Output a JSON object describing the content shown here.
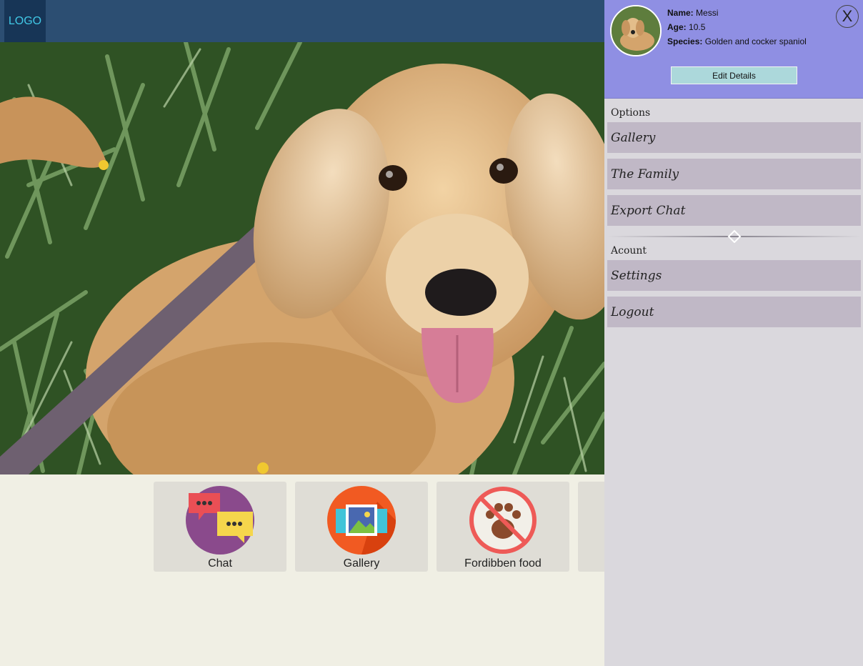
{
  "header": {
    "logo": "LOGO"
  },
  "tiles": [
    {
      "label": "Chat",
      "icon": "chat-icon"
    },
    {
      "label": "Gallery",
      "icon": "gallery-icon"
    },
    {
      "label": "Fordibben food",
      "icon": "forbidden-food-icon"
    }
  ],
  "profile": {
    "name_label": "Name:",
    "name": "Messi",
    "age_label": "Age:",
    "age": "10.5",
    "species_label": "Species:",
    "species": "Golden and cocker spaniol",
    "close": "X",
    "edit": "Edit Details"
  },
  "menu": {
    "options_title": "Options",
    "options": [
      "Gallery",
      "The Family",
      "Export Chat"
    ],
    "account_title": "Acount",
    "account": [
      "Settings",
      "Logout"
    ]
  },
  "colors": {
    "topbar": "#2c4e72",
    "logo_bg": "#173556",
    "logo_text": "#41c8e6",
    "panel_header": "#8f8fe3",
    "menu_item": "#c0b8c6",
    "edit_button": "#acd8db",
    "page_bg": "#f0efe4"
  }
}
